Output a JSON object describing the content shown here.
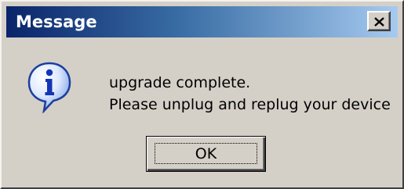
{
  "window": {
    "title": "Message",
    "close_icon": "close-icon"
  },
  "dialog": {
    "icon": "info-icon",
    "message_line_1": "upgrade complete.",
    "message_line_2": "Please unplug and replug your device",
    "ok_label": "OK"
  },
  "colors": {
    "title_gradient_start": "#0a246a",
    "title_gradient_end": "#a6caf0",
    "window_face": "#d4d0c8"
  }
}
